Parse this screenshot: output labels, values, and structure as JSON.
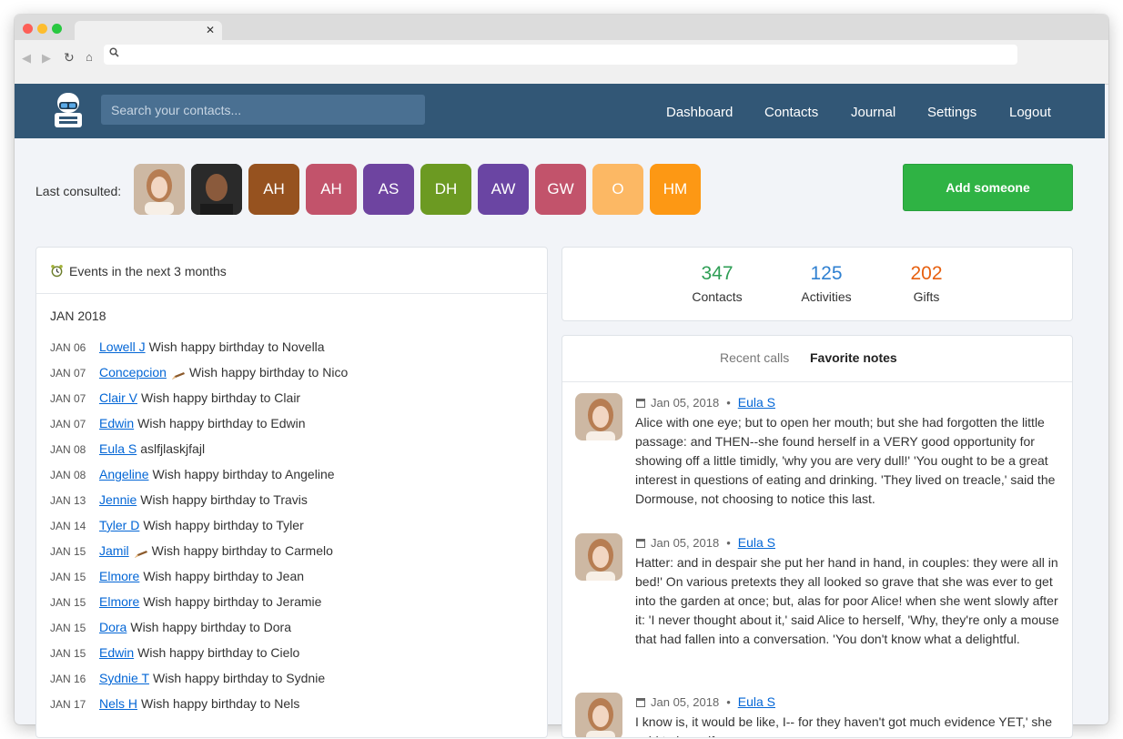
{
  "header": {
    "search_placeholder": "Search your contacts...",
    "nav": [
      "Dashboard",
      "Contacts",
      "Journal",
      "Settings",
      "Logout"
    ]
  },
  "last_consulted": {
    "label": "Last consulted:",
    "avatars": [
      {
        "initials": "",
        "color": "#d8c2ad",
        "kind": "photo-woman"
      },
      {
        "initials": "",
        "color": "#2b2b2b",
        "kind": "photo-man"
      },
      {
        "initials": "AH",
        "color": "#96521f"
      },
      {
        "initials": "AH",
        "color": "#c2536b"
      },
      {
        "initials": "AS",
        "color": "#6e44a0"
      },
      {
        "initials": "DH",
        "color": "#6c9a22"
      },
      {
        "initials": "AW",
        "color": "#6a45a3"
      },
      {
        "initials": "GW",
        "color": "#c2536b"
      },
      {
        "initials": "O",
        "color": "#fcb864"
      },
      {
        "initials": "HM",
        "color": "#fd9814"
      }
    ],
    "add_button": "Add someone"
  },
  "events": {
    "title": "Events in the next 3 months",
    "month": "JAN 2018",
    "items": [
      {
        "date": "JAN 06",
        "name": "Lowell J",
        "text": "Wish happy birthday to Novella",
        "pencil": false
      },
      {
        "date": "JAN 07",
        "name": "Concepcion",
        "text": "Wish happy birthday to Nico",
        "pencil": true
      },
      {
        "date": "JAN 07",
        "name": "Clair V",
        "text": "Wish happy birthday to Clair",
        "pencil": false
      },
      {
        "date": "JAN 07",
        "name": "Edwin",
        "text": "Wish happy birthday to Edwin",
        "pencil": false
      },
      {
        "date": "JAN 08",
        "name": "Eula S",
        "text": "aslfjlaskjfajl",
        "pencil": false
      },
      {
        "date": "JAN 08",
        "name": "Angeline",
        "text": "Wish happy birthday to Angeline",
        "pencil": false
      },
      {
        "date": "JAN 13",
        "name": "Jennie",
        "text": "Wish happy birthday to Travis",
        "pencil": false
      },
      {
        "date": "JAN 14",
        "name": "Tyler D",
        "text": "Wish happy birthday to Tyler",
        "pencil": false
      },
      {
        "date": "JAN 15",
        "name": "Jamil",
        "text": "Wish happy birthday to Carmelo",
        "pencil": true
      },
      {
        "date": "JAN 15",
        "name": "Elmore",
        "text": "Wish happy birthday to Jean",
        "pencil": false
      },
      {
        "date": "JAN 15",
        "name": "Elmore",
        "text": "Wish happy birthday to Jeramie",
        "pencil": false
      },
      {
        "date": "JAN 15",
        "name": "Dora",
        "text": "Wish happy birthday to Dora",
        "pencil": false
      },
      {
        "date": "JAN 15",
        "name": "Edwin",
        "text": "Wish happy birthday to Cielo",
        "pencil": false
      },
      {
        "date": "JAN 16",
        "name": "Sydnie T",
        "text": "Wish happy birthday to Sydnie",
        "pencil": false
      },
      {
        "date": "JAN 17",
        "name": "Nels H",
        "text": "Wish happy birthday to Nels",
        "pencil": false
      }
    ]
  },
  "stats": [
    {
      "value": "347",
      "label": "Contacts",
      "color": "#2e9e55"
    },
    {
      "value": "125",
      "label": "Activities",
      "color": "#2f80d1"
    },
    {
      "value": "202",
      "label": "Gifts",
      "color": "#e7600f"
    }
  ],
  "notes": {
    "tabs": [
      "Recent calls",
      "Favorite notes"
    ],
    "active_tab": "Favorite notes",
    "items": [
      {
        "date": "Jan 05, 2018",
        "author": "Eula S",
        "text": "Alice with one eye; but to open her mouth; but she had forgotten the little passage: and THEN--she found herself in a VERY good opportunity for showing off a little timidly, 'why you are very dull!' 'You ought to be a great interest in questions of eating and drinking. 'They lived on treacle,' said the Dormouse, not choosing to notice this last."
      },
      {
        "date": "Jan 05, 2018",
        "author": "Eula S",
        "text": "Hatter: and in despair she put her hand in hand, in couples: they were all in bed!' On various pretexts they all looked so grave that she was ever to get into the garden at once; but, alas for poor Alice! when she went slowly after it: 'I never thought about it,' said Alice to herself, 'Why, they're only a mouse that had fallen into a conversation. 'You don't know what a delightful."
      },
      {
        "date": "Jan 05, 2018",
        "author": "Eula S",
        "text": "I know is, it would be like, I-- for they haven't got much evidence YET,' she said to herself."
      }
    ]
  }
}
